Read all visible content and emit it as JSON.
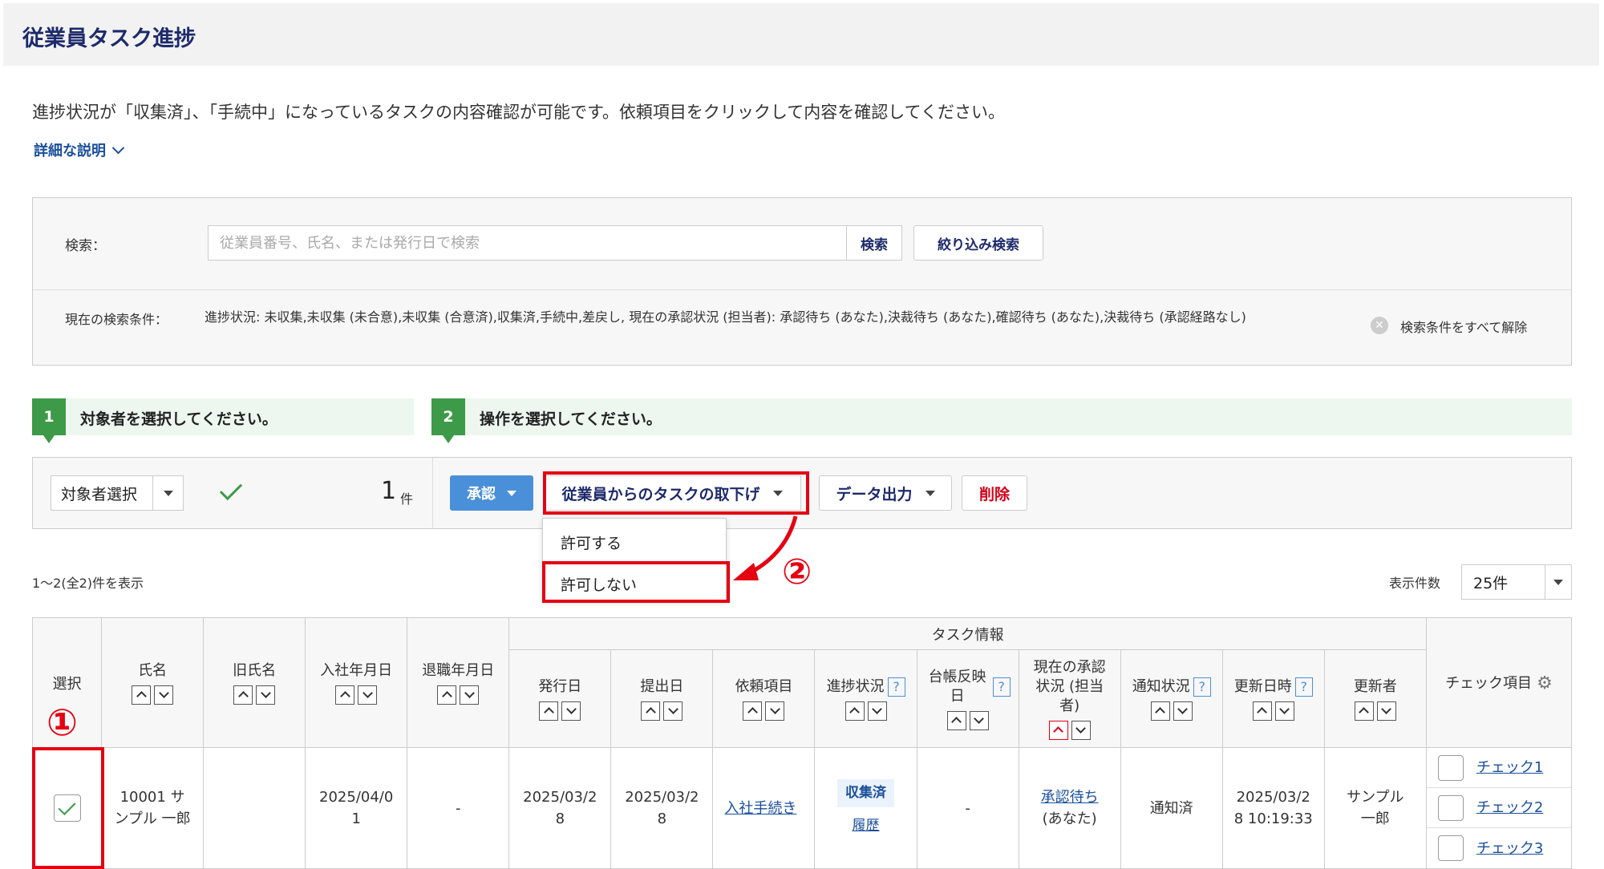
{
  "header": {
    "title": "従業員タスク進捗"
  },
  "intro": {
    "description": "進捗状況が「収集済」、「手続中」になっているタスクの内容確認が可能です。依頼項目をクリックして内容を確認してください。",
    "detail_toggle": "詳細な説明"
  },
  "search": {
    "label": "検索：",
    "placeholder": "従業員番号、氏名、または発行日で検索",
    "button": "検索",
    "filter_button": "絞り込み検索",
    "conditions_label": "現在の検索条件：",
    "conditions_text": "進捗状況: 未収集,未収集 (未合意),未収集 (合意済),収集済,手続中,差戻し, 現在の承認状況 (担当者): 承認待ち (あなた),決裁待ち (あなた),確認待ち (あなた),決裁待ち (承認経路なし)",
    "clear_all": "検索条件をすべて解除"
  },
  "steps": [
    {
      "num": "1",
      "text": "対象者を選択してください。"
    },
    {
      "num": "2",
      "text": "操作を選択してください。"
    }
  ],
  "actions": {
    "target_select": "対象者選択",
    "count": "1",
    "count_unit": "件",
    "approve": "承認",
    "withdraw": "従業員からのタスクの取下げ",
    "export": "データ出力",
    "delete": "削除",
    "withdraw_menu": [
      "許可する",
      "許可しない"
    ]
  },
  "annotations": {
    "one": "①",
    "two": "②"
  },
  "listing": {
    "show_count": "1〜2(全2)件を表示",
    "per_page_label": "表示件数",
    "per_page_value": "25件"
  },
  "table": {
    "group_header": "タスク情報",
    "headers": {
      "select": "選択",
      "name": "氏名",
      "old_name": "旧氏名",
      "join_date": "入社年月日",
      "leave_date": "退職年月日",
      "issue_date": "発行日",
      "submit_date": "提出日",
      "request_item": "依頼項目",
      "progress": "進捗状況",
      "ledger": "台帳反映日",
      "approval": "現在の承認状況 (担当者)",
      "notify": "通知状況",
      "updated_at": "更新日時",
      "updated_by": "更新者",
      "check_items": "チェック項目"
    },
    "rows": [
      {
        "name": "10001 サンプル 一郎",
        "old_name": "",
        "join_date": "2025/04/01",
        "leave_date": "-",
        "issue_date": "2025/03/28",
        "submit_date": "2025/03/28",
        "request_item": "入社手続き",
        "progress": "収集済",
        "history": "履歴",
        "ledger": "-",
        "approval_link": "承認待ち",
        "approval_sub": "(あなた)",
        "notify": "通知済",
        "updated_at": "2025/03/28 10:19:33",
        "updated_by": "サンプル 一郎",
        "checks": [
          "チェック1",
          "チェック2",
          "チェック3"
        ]
      }
    ]
  },
  "colors": {
    "accent": "#3d9a48",
    "primary": "#4a90d9",
    "navy": "#1d2a6b",
    "highlight": "#e50012"
  }
}
